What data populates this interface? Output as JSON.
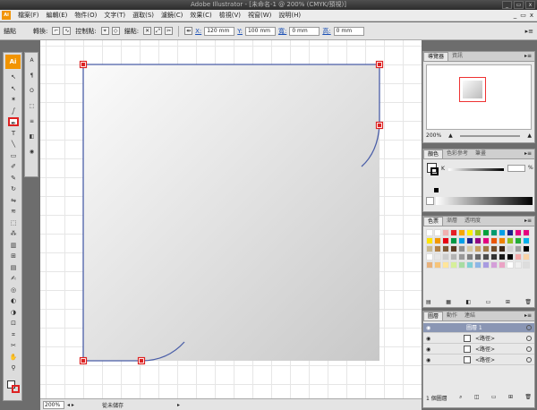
{
  "window": {
    "title": "Adobe Illustrator - [未命名-1 @ 200% (CMYK/預視)]",
    "buttons": [
      "_",
      "▭",
      "x"
    ]
  },
  "menu": {
    "items": [
      "檔案(F)",
      "編輯(E)",
      "物件(O)",
      "文字(T)",
      "選取(S)",
      "濾鏡(C)",
      "效果(C)",
      "檢視(V)",
      "視窗(W)",
      "說明(H)"
    ],
    "mini_buttons": [
      "_",
      "▭",
      "x"
    ]
  },
  "control": {
    "selection_label": "錨點",
    "convert_label": "轉換:",
    "handles_label": "控制點:",
    "anchors_label": "錨點:",
    "x_label": "X:",
    "x_value": "120 mm",
    "y_label": "Y:",
    "y_value": "100 mm",
    "w_label": "寬:",
    "w_value": "0 mm",
    "h_label": "高:",
    "h_value": "0 mm"
  },
  "toolbox": {
    "logo": "Ai",
    "tools": [
      {
        "name": "selection-tool",
        "glyph": "↖"
      },
      {
        "name": "direct-selection-tool",
        "glyph": "↖"
      },
      {
        "name": "magic-wand-tool",
        "glyph": "✶"
      },
      {
        "name": "lasso-tool",
        "glyph": "ഽ"
      },
      {
        "name": "pen-tool",
        "glyph": "✒"
      },
      {
        "name": "type-tool",
        "glyph": "T"
      },
      {
        "name": "line-tool",
        "glyph": "╲"
      },
      {
        "name": "rectangle-tool",
        "glyph": "▭"
      },
      {
        "name": "paintbrush-tool",
        "glyph": "✐"
      },
      {
        "name": "pencil-tool",
        "glyph": "✎"
      },
      {
        "name": "rotate-tool",
        "glyph": "↻"
      },
      {
        "name": "reflect-tool",
        "glyph": "⇋"
      },
      {
        "name": "warp-tool",
        "glyph": "≋"
      },
      {
        "name": "free-transform-tool",
        "glyph": "⬚"
      },
      {
        "name": "symbol-sprayer-tool",
        "glyph": "⁂"
      },
      {
        "name": "column-graph-tool",
        "glyph": "▥"
      },
      {
        "name": "mesh-tool",
        "glyph": "⊞"
      },
      {
        "name": "gradient-tool",
        "glyph": "▤"
      },
      {
        "name": "eyedropper-tool",
        "glyph": "✍"
      },
      {
        "name": "blend-tool",
        "glyph": "◎"
      },
      {
        "name": "live-paint-tool",
        "glyph": "◐"
      },
      {
        "name": "live-paint-selection-tool",
        "glyph": "◑"
      },
      {
        "name": "artboard-tool",
        "glyph": "⊡"
      },
      {
        "name": "slice-tool",
        "glyph": "⌗"
      },
      {
        "name": "scissors-tool",
        "glyph": "✂"
      },
      {
        "name": "hand-tool",
        "glyph": "✋"
      },
      {
        "name": "zoom-tool",
        "glyph": "⚲"
      }
    ]
  },
  "panel_strip": {
    "items": [
      {
        "name": "character-panel-icon",
        "glyph": "A"
      },
      {
        "name": "paragraph-panel-icon",
        "glyph": "¶"
      },
      {
        "name": "opentype-panel-icon",
        "glyph": "O"
      },
      {
        "name": "transform-panel-icon",
        "glyph": "⬚"
      },
      {
        "name": "align-panel-icon",
        "glyph": "≡"
      },
      {
        "name": "pathfinder-panel-icon",
        "glyph": "◧"
      },
      {
        "name": "appearance-panel-icon",
        "glyph": "◉"
      }
    ]
  },
  "status": {
    "zoom": "200%",
    "state": "從未儲存"
  },
  "navigator": {
    "tabs": [
      "導覽器",
      "資訊"
    ],
    "zoom": "200%"
  },
  "color": {
    "tabs": [
      "顏色",
      "色彩參考",
      "筆畫"
    ],
    "channel": "K",
    "percent": "%"
  },
  "swatches": {
    "tabs": [
      "色票",
      "漸層",
      "透明度"
    ],
    "colors": [
      "#ffffff",
      "#ffffff",
      "#f0b0b0",
      "#e61e25",
      "#f7a600",
      "#fff100",
      "#9bc31c",
      "#00a23c",
      "#009a6d",
      "#009fe8",
      "#1d2088",
      "#e6007e",
      "#e5007f",
      "#ffe500",
      "#f39800",
      "#e60012",
      "#009944",
      "#00a0e9",
      "#1d2088",
      "#920783",
      "#e4007f",
      "#ea5504",
      "#f08300",
      "#8fc31f",
      "#22ac38",
      "#00b0ec",
      "#c9b98f",
      "#b28146",
      "#7d5a37",
      "#5a3a22",
      "#8f8f8f",
      "#d6c8a3",
      "#c7a062",
      "#a27b46",
      "#6f4c2a",
      "#3b2718",
      "#d0d0d0",
      "#a0a0a0",
      "#000000",
      "#ffffff",
      "#e6e6e6",
      "#cccccc",
      "#b3b3b3",
      "#999999",
      "#808080",
      "#666666",
      "#4d4d4d",
      "#333333",
      "#1a1a1a",
      "#000000",
      "#f4a6a6",
      "#f9d3a6",
      "#e7b17c",
      "#f6c47a",
      "#ffe59a",
      "#d6ef9a",
      "#a8dca2",
      "#80cfd4",
      "#8db6e6",
      "#a89be0",
      "#d49fd9",
      "#eba3c5",
      "#ffffff",
      "#eeeeee",
      "#dddddd"
    ]
  },
  "layers": {
    "tabs": [
      "圖層",
      "動作",
      "連結"
    ],
    "rows": [
      {
        "label": "圖層 1",
        "top": true
      },
      {
        "label": "<路徑>",
        "top": false
      },
      {
        "label": "<路徑>",
        "top": false
      },
      {
        "label": "<路徑>",
        "top": false
      }
    ],
    "count": "1 個圖層"
  }
}
